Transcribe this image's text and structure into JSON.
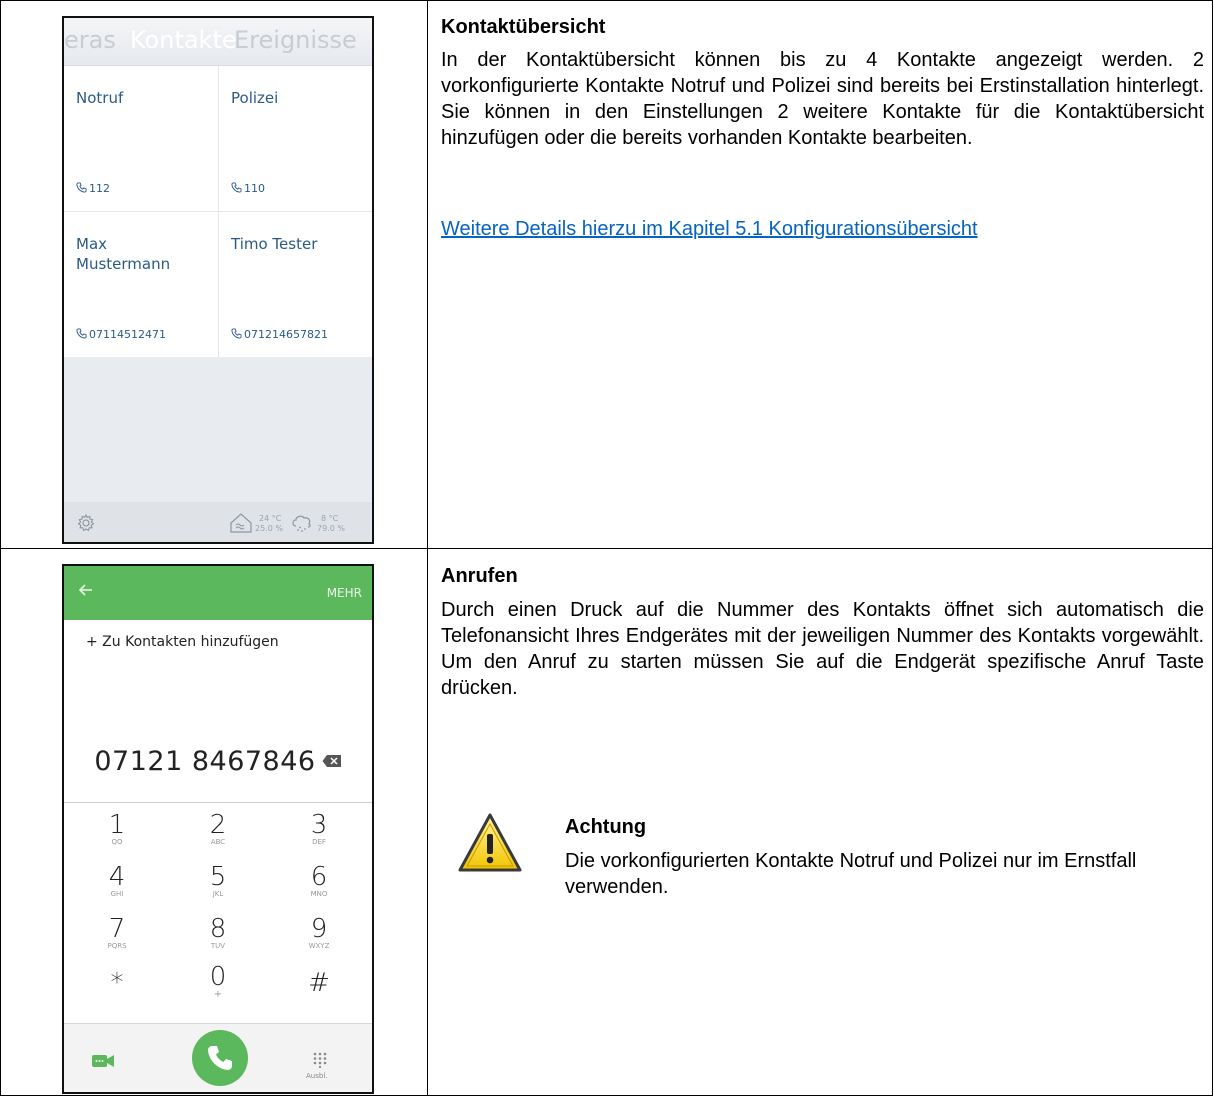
{
  "contacts_screen": {
    "tabs": {
      "prev": "eras",
      "active": "Kontakte",
      "next": "Ereignisse"
    },
    "contacts": [
      {
        "name": "Notruf",
        "number": "112"
      },
      {
        "name": "Polizei",
        "number": "110"
      },
      {
        "name": "Max Mustermann",
        "number": "07114512471"
      },
      {
        "name": "Timo Tester",
        "number": "071214657821"
      }
    ],
    "footer": {
      "indoor_temp": "24 °C",
      "indoor_humidity": "25.0 %",
      "outdoor_temp": "8 °C",
      "outdoor_humidity": "79.0 %",
      "icons": [
        "gear-icon",
        "home-climate-icon",
        "cloud-rain-icon"
      ]
    }
  },
  "section1": {
    "title": "Kontaktübersicht",
    "paragraph": "In der Kontaktübersicht können bis zu 4 Kontakte angezeigt werden. 2 vorkonfigurierte Kontakte Notruf und Polizei sind bereits bei Erstinstallation hinterlegt. Sie können in den Einstellungen 2 weitere Kontakte für die Kontaktübersicht hinzufügen oder die bereits vorhanden Kontakte bearbeiten.",
    "link": "Weitere Details hierzu im Kapitel 5.1 Konfigurationsübersicht"
  },
  "dialer_screen": {
    "more_label": "MEHR",
    "add_contact_label": "+ Zu Kontakten hinzufügen",
    "number": "07121 8467846",
    "keys": [
      {
        "digit": "1",
        "letters": "QO"
      },
      {
        "digit": "2",
        "letters": "ABC"
      },
      {
        "digit": "3",
        "letters": "DEF"
      },
      {
        "digit": "4",
        "letters": "GHI"
      },
      {
        "digit": "5",
        "letters": "JKL"
      },
      {
        "digit": "6",
        "letters": "MNO"
      },
      {
        "digit": "7",
        "letters": "PQRS"
      },
      {
        "digit": "8",
        "letters": "TUV"
      },
      {
        "digit": "9",
        "letters": "WXYZ"
      },
      {
        "digit": "*",
        "letters": ""
      },
      {
        "digit": "0",
        "letters": "+"
      },
      {
        "digit": "#",
        "letters": ""
      }
    ],
    "hide_label": "Ausbl.",
    "accent_color": "#5cb85c"
  },
  "section2": {
    "title": "Anrufen",
    "paragraph": "Durch einen Druck auf die Nummer des Kontakts öffnet sich automatisch die Telefonansicht Ihres Endgerätes mit der jeweiligen Nummer des Kontakts vorgewählt. Um den Anruf zu starten müssen Sie auf die Endgerät spezifische Anruf Taste drücken.",
    "warning_title": "Achtung",
    "warning_text": "Die vorkonfigurierten Kontakte Notruf und Polizei nur im Ernstfall verwenden."
  }
}
